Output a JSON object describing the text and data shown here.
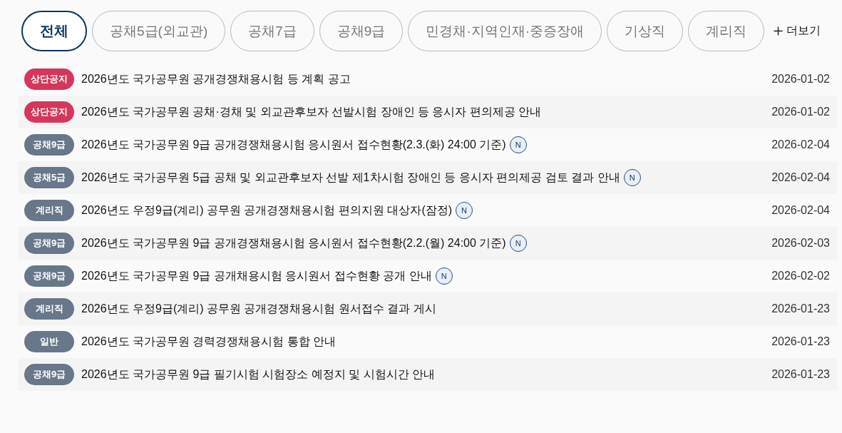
{
  "filter_tabs": [
    {
      "label": "전체",
      "selected": true
    },
    {
      "label": "공채5급(외교관)",
      "selected": false
    },
    {
      "label": "공채7급",
      "selected": false
    },
    {
      "label": "공채9급",
      "selected": false
    },
    {
      "label": "민경채·지역인재·중증장애",
      "selected": false
    },
    {
      "label": "기상직",
      "selected": false
    },
    {
      "label": "계리직",
      "selected": false
    }
  ],
  "more_link": {
    "label": "더보기"
  },
  "notices": [
    {
      "category": "상단공지",
      "color": "#d4375a",
      "title": "2026년도 국가공무원 공개경쟁채용시험 등 계획 공고",
      "date": "2026-01-02"
    },
    {
      "category": "상단공지",
      "color": "#d4375a",
      "title": "2026년도 국가공무원 공채·경채 및 외교관후보자 선발시험 장애인 등 응시자 편의제공 안내",
      "date": "2026-01-02"
    },
    {
      "category": "공채9급",
      "color": "#687789",
      "title": "2026년도 국가공무원 9급 공개경쟁채용시험 응시원서 접수현황(2.3.(화) 24:00 기준)",
      "new_badge": "N",
      "date": "2026-02-04"
    },
    {
      "category": "공채5급",
      "color": "#687789",
      "title": "2026년도 국가공무원 5급 공채 및 외교관후보자 선발 제1차시험 장애인 등 응시자 편의제공 검토 결과 안내",
      "new_badge": "N",
      "date": "2026-02-04"
    },
    {
      "category": "계리직",
      "color": "#687789",
      "title": "2026년도 우정9급(계리) 공무원 공개경쟁채용시험 편의지원 대상자(잠정)",
      "new_badge": "N",
      "date": "2026-02-04"
    },
    {
      "category": "공채9급",
      "color": "#687789",
      "title": "2026년도 국가공무원 9급 공개경쟁채용시험 응시원서 접수현황(2.2.(월) 24:00 기준)",
      "new_badge": "N",
      "date": "2026-02-03"
    },
    {
      "category": "공채9급",
      "color": "#687789",
      "title": "2026년도 국가공무원 9급 공개채용시험 응시원서 접수현황 공개 안내",
      "new_badge": "N",
      "date": "2026-02-02"
    },
    {
      "category": "계리직",
      "color": "#687789",
      "title": "2026년도 우정9급(계리) 공무원 공개경쟁채용시험 원서접수 결과 게시",
      "date": "2026-01-23"
    },
    {
      "category": "일반",
      "color": "#687789",
      "title": "2026년도 국가공무원 경력경쟁채용시험 통합 안내",
      "date": "2026-01-23"
    },
    {
      "category": "공채9급",
      "color": "#687789",
      "title": "2026년도 국가공무원 9급 필기시험 시험장소 예정지 및 시험시간 안내",
      "date": "2026-01-23"
    }
  ]
}
